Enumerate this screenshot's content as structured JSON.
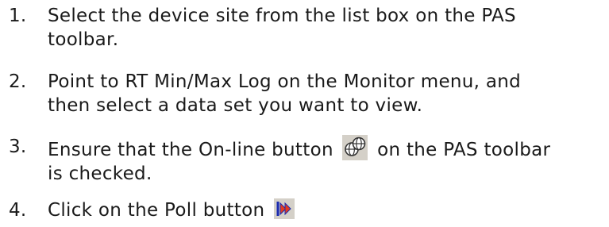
{
  "steps": [
    {
      "number": "1.",
      "lines": [
        "Select the device site from the list box on the PAS",
        "toolbar."
      ]
    },
    {
      "number": "2.",
      "lines": [
        "Point to RT Min/Max Log on the Monitor menu, and",
        "then select a data set you want to view."
      ]
    },
    {
      "number": "3.",
      "line1_before": "Ensure that the On-line button",
      "line1_after": "on the PAS toolbar",
      "line2": "is checked.",
      "icon": "online-button-icon"
    },
    {
      "number": "4.",
      "text": "Click on the Poll button",
      "icon": "poll-button-icon"
    }
  ],
  "colors": {
    "text": "#1a1a1a",
    "icon_bg": "#d4d0c8",
    "poll_blue": "#1c2bb0",
    "poll_red": "#e23b1f"
  }
}
